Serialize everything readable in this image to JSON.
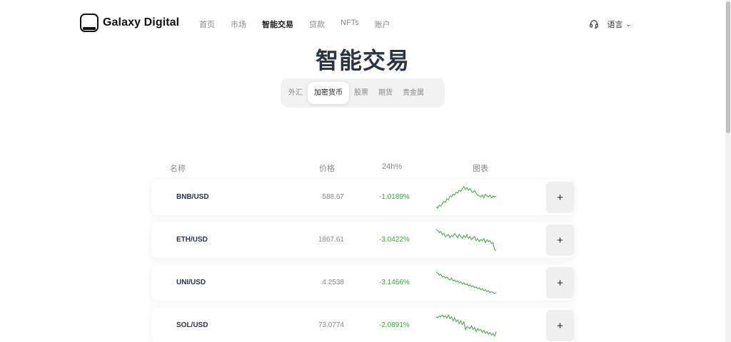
{
  "brand": {
    "name": "Galaxy Digital"
  },
  "nav": [
    {
      "label": "首页",
      "active": false
    },
    {
      "label": "市场",
      "active": false
    },
    {
      "label": "智能交易",
      "active": true
    },
    {
      "label": "贷款",
      "active": false
    },
    {
      "label": "NFTs",
      "active": false
    },
    {
      "label": "账户",
      "active": false
    }
  ],
  "header": {
    "language": "语言",
    "support_icon": "headset-icon"
  },
  "title": "智能交易",
  "tabs": [
    {
      "label": "外汇",
      "active": false
    },
    {
      "label": "加密货币",
      "active": true
    },
    {
      "label": "股票",
      "active": false
    },
    {
      "label": "期货",
      "active": false
    },
    {
      "label": "贵金属",
      "active": false
    }
  ],
  "table": {
    "headers": {
      "name": "名称",
      "price": "价格",
      "change": "24h%",
      "chart": "图表"
    },
    "rows": [
      {
        "symbol": "BNB/USD",
        "price": "588.67",
        "change": "-1.0189%",
        "add": "+",
        "spark": [
          3,
          2,
          5,
          4,
          7,
          9,
          8,
          12,
          11,
          15,
          14,
          17,
          16,
          19,
          18,
          21,
          20,
          23,
          25,
          22,
          24,
          21,
          23,
          20,
          19,
          21,
          18,
          16,
          15,
          14,
          16,
          13,
          17,
          15,
          14,
          16,
          13,
          15,
          14,
          15
        ]
      },
      {
        "symbol": "ETH/USD",
        "price": "1867.61",
        "change": "-3.0422%",
        "add": "+",
        "spark": [
          28,
          27,
          25,
          26,
          23,
          24,
          21,
          22,
          23,
          20,
          22,
          21,
          24,
          22,
          20,
          23,
          21,
          19,
          22,
          20,
          23,
          19,
          21,
          18,
          20,
          21,
          17,
          19,
          16,
          18,
          17,
          19,
          15,
          18,
          16,
          17,
          14,
          15,
          8,
          7
        ]
      },
      {
        "symbol": "UNI/USD",
        "price": "4.2538",
        "change": "-3.1466%",
        "add": "+",
        "spark": [
          30,
          29,
          27,
          28,
          25,
          26,
          24,
          25,
          23,
          22,
          24,
          21,
          22,
          20,
          21,
          19,
          20,
          18,
          19,
          17,
          18,
          16,
          17,
          15,
          16,
          14,
          15,
          13,
          14,
          12,
          13,
          11,
          12,
          10,
          11,
          9,
          10,
          9,
          8,
          9
        ]
      },
      {
        "symbol": "SOL/USD",
        "price": "73.0774",
        "change": "-2.0891%",
        "add": "+",
        "spark": [
          24,
          23,
          25,
          24,
          26,
          24,
          25,
          23,
          26,
          22,
          24,
          20,
          23,
          19,
          21,
          17,
          20,
          16,
          19,
          11,
          14,
          13,
          12,
          15,
          11,
          13,
          9,
          12,
          10,
          11,
          8,
          10,
          7,
          9,
          6,
          8,
          5,
          7,
          4,
          9
        ]
      }
    ]
  },
  "colors": {
    "positive_green": "#3aa63a",
    "title": "#2c3440"
  }
}
